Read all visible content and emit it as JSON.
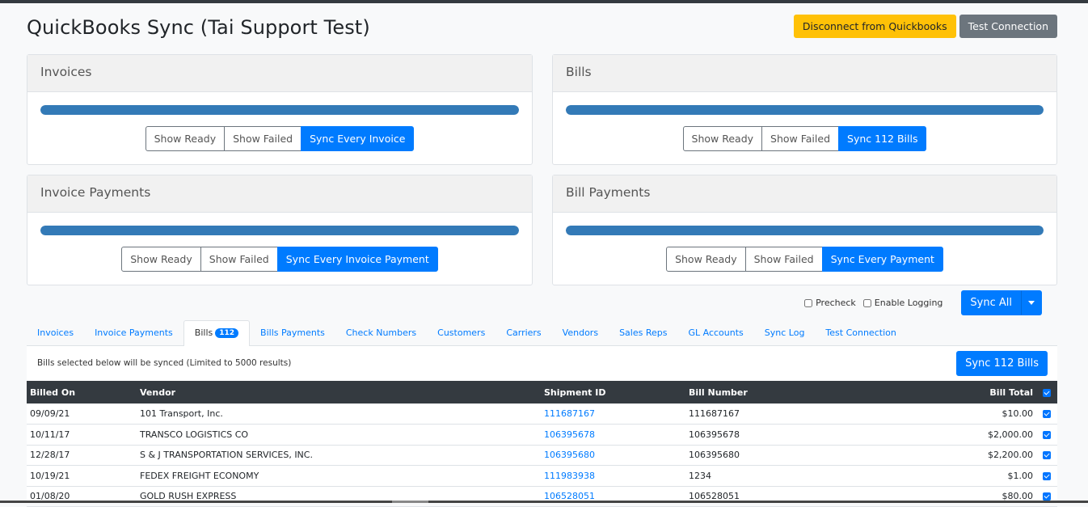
{
  "page": {
    "title": "QuickBooks Sync (Tai Support Test)",
    "disconnect_label": "Disconnect from Quickbooks",
    "test_connection_label": "Test Connection"
  },
  "cards": {
    "invoices": {
      "title": "Invoices",
      "progress": 1.0,
      "show_ready": "Show Ready",
      "show_failed": "Show Failed",
      "sync": "Sync Every Invoice"
    },
    "bills": {
      "title": "Bills",
      "progress": 1.0,
      "show_ready": "Show Ready",
      "show_failed": "Show Failed",
      "sync": "Sync 112 Bills"
    },
    "invoice_payments": {
      "title": "Invoice Payments",
      "progress": 1.0,
      "show_ready": "Show Ready",
      "show_failed": "Show Failed",
      "sync": "Sync Every Invoice Payment"
    },
    "bill_payments": {
      "title": "Bill Payments",
      "progress": 1.0,
      "show_ready": "Show Ready",
      "show_failed": "Show Failed",
      "sync": "Sync Every Payment"
    }
  },
  "controls": {
    "precheck": "Precheck",
    "enable_logging": "Enable Logging",
    "sync_all": "Sync All"
  },
  "tabs": [
    {
      "label": "Invoices"
    },
    {
      "label": "Invoice Payments"
    },
    {
      "label": "Bills",
      "badge": "112",
      "active": true
    },
    {
      "label": "Bills Payments"
    },
    {
      "label": "Check Numbers"
    },
    {
      "label": "Customers"
    },
    {
      "label": "Carriers"
    },
    {
      "label": "Vendors"
    },
    {
      "label": "Sales Reps"
    },
    {
      "label": "GL Accounts"
    },
    {
      "label": "Sync Log"
    },
    {
      "label": "Test Connection"
    }
  ],
  "panel": {
    "note": "Bills selected below will be synced (Limited to 5000 results)",
    "sync_button": "Sync 112 Bills"
  },
  "table": {
    "headers": {
      "billed_on": "Billed On",
      "vendor": "Vendor",
      "shipment_id": "Shipment ID",
      "bill_number": "Bill Number",
      "bill_total": "Bill Total"
    },
    "rows": [
      {
        "billed_on": "09/09/21",
        "vendor": "101 Transport, Inc.",
        "shipment_id": "111687167",
        "bill_number": "111687167",
        "bill_total": "$10.00"
      },
      {
        "billed_on": "10/11/17",
        "vendor": "TRANSCO LOGISTICS CO",
        "shipment_id": "106395678",
        "bill_number": "106395678",
        "bill_total": "$2,000.00"
      },
      {
        "billed_on": "12/28/17",
        "vendor": "S & J TRANSPORTATION SERVICES, INC.",
        "shipment_id": "106395680",
        "bill_number": "106395680",
        "bill_total": "$2,200.00"
      },
      {
        "billed_on": "10/19/21",
        "vendor": "FEDEX FREIGHT ECONOMY",
        "shipment_id": "111983938",
        "bill_number": "1234",
        "bill_total": "$1.00"
      },
      {
        "billed_on": "01/08/20",
        "vendor": "GOLD RUSH EXPRESS",
        "shipment_id": "106528051",
        "bill_number": "106528051",
        "bill_total": "$80.00"
      }
    ]
  }
}
